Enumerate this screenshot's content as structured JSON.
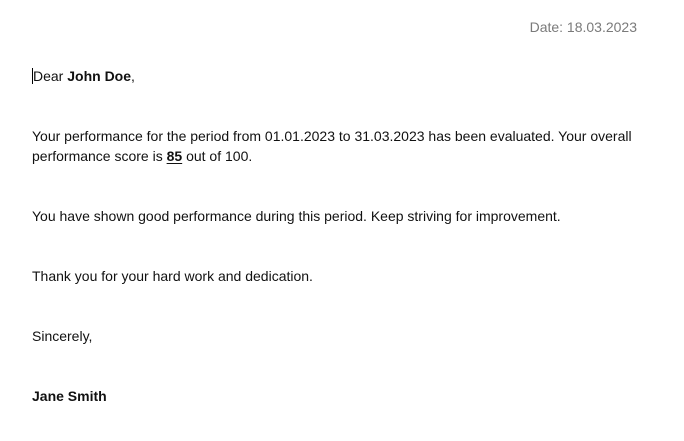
{
  "header": {
    "date_label": "Date: 18.03.2023"
  },
  "letter": {
    "salutation_prefix": "Dear ",
    "recipient_name": "John Doe",
    "salutation_suffix": ",",
    "evaluation_text_before_score": "Your performance for the period from 01.01.2023 to 31.03.2023 has been evaluated. Your overall performance score is ",
    "score": "85",
    "evaluation_text_after_score": " out of 100.",
    "feedback": "You have shown good performance during this period. Keep striving for improvement.",
    "thanks": "Thank you for your hard work and dedication.",
    "closing": "Sincerely,",
    "signature_name": "Jane Smith"
  }
}
